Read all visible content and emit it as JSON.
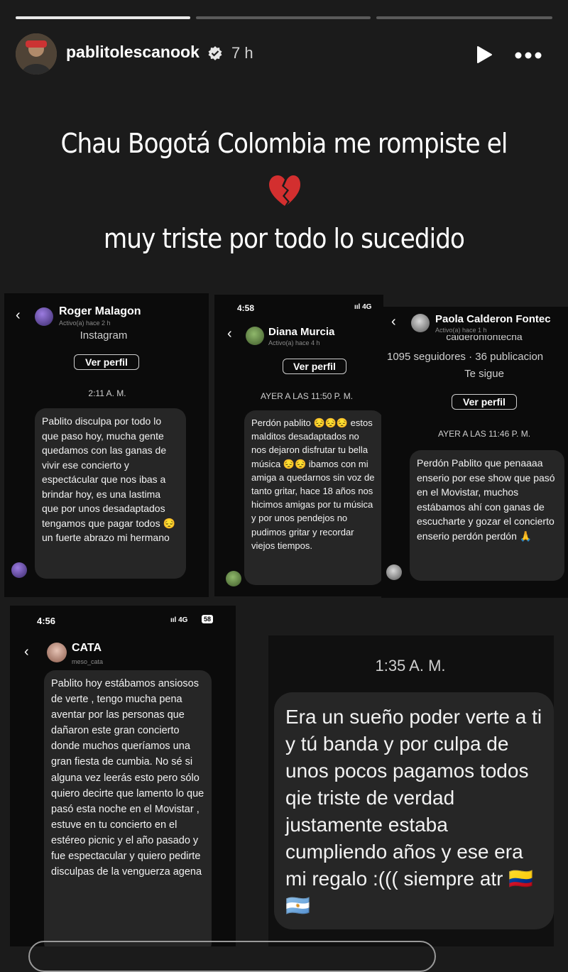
{
  "story": {
    "progress": [
      1.0,
      0.0,
      0.0
    ],
    "username": "pablitolescanook",
    "time_ago": "7 h",
    "caption_line1": "Chau Bogotá Colombia me rompiste el",
    "caption_emoji": "💔",
    "caption_line2": "muy triste por todo lo sucedido"
  },
  "shot1": {
    "name": "Roger Malagon",
    "active": "Activo(a) hace 2 h",
    "platform": "Instagram",
    "profile_btn": "Ver perfil",
    "timestamp": "2:11 A. M.",
    "message": "Pablito disculpa por todo lo que paso hoy, mucha gente quedamos con las ganas de vivir ese concierto y espectácular que nos ibas a brindar hoy, es una lastima que por unos desadaptados tengamos que pagar todos 😔 un fuerte abrazo mi hermano"
  },
  "shot2": {
    "clock": "4:58",
    "signal": "ııl 4G",
    "name": "Diana Murcia",
    "active": "Activo(a) hace 4 h",
    "profile_btn": "Ver perfil",
    "timestamp": "AYER A LAS 11:50 P. M.",
    "message": "Perdón pablito 😔😔😔 estos malditos desadaptados no nos dejaron disfrutar tu bella música 😔😔 ibamos con mi amiga a quedarnos sin voz de tanto gritar, hace 18 años nos hicimos amigas por tu música y por unos pendejos no pudimos gritar y recordar viejos tiempos."
  },
  "shot3": {
    "name": "Paola Calderon Fontec",
    "active": "Activo(a) hace 1 h",
    "handle": "calderonfontecha",
    "stats": "1095 seguidores · 36 publicacion",
    "follows": "Te sigue",
    "profile_btn": "Ver perfil",
    "timestamp": "AYER A LAS 11:46 P. M.",
    "message": "Perdón Pablito que penaaaa enserio por ese show que pasó en el Movistar, muchos estábamos ahí con ganas de escucharte y gozar el concierto enserio perdón perdón 🙏"
  },
  "shot4": {
    "clock": "4:56",
    "signal": "ııl 4G",
    "battery": "58",
    "name": "CATA",
    "handle": "meso_cata",
    "message": "Pablito hoy estábamos ansiosos de verte , tengo mucha pena aventar por las personas que dañaron este gran concierto donde muchos queríamos una gran fiesta de cumbia. No sé si alguna vez leerás esto pero sólo quiero decirte que lamento lo que pasó esta noche en el Movistar , estuve en tu concierto en el estéreo picnic y el año pasado y fue espectacular y quiero pedirte disculpas de la venguerza agena"
  },
  "shot5": {
    "timestamp": "1:35 A. M.",
    "message": "Era un sueño poder verte a ti y tú banda y por culpa de unos pocos pagamos todos qie triste de verdad justamente estaba cumpliendo años y ese era mi regalo :((( siempre atr 🇨🇴 🇦🇷"
  },
  "colors": {
    "background": "#1b1b1b",
    "bubble": "#262626",
    "card": "#0b0b0b",
    "verified": "#ffffff"
  }
}
